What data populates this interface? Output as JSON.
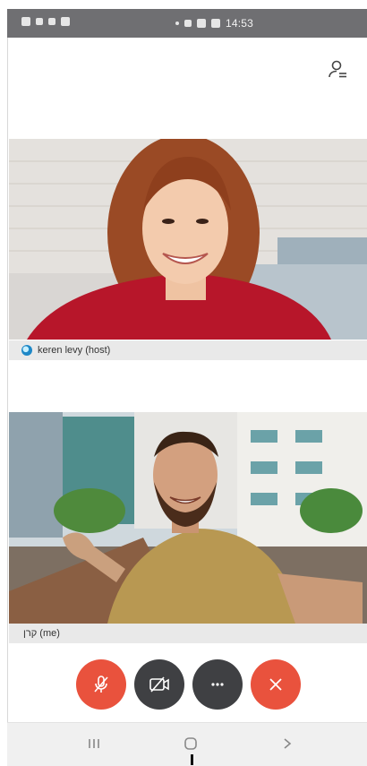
{
  "status_bar": {
    "time": "14:53",
    "icons": [
      "lock-icon",
      "signal-icon",
      "wifi-icon",
      "gallery-icon",
      "dot-icon",
      "link-icon",
      "cast-icon",
      "image-icon"
    ]
  },
  "header": {
    "participants_icon": "participants-icon"
  },
  "video_tiles": [
    {
      "id": "host",
      "label": "keren levy (host)",
      "status_icon": "connection-status-icon"
    },
    {
      "id": "me",
      "label": "קרן (me)"
    }
  ],
  "controls": [
    {
      "name": "mute-mic",
      "icon": "mic-off-icon",
      "color": "#e9523d"
    },
    {
      "name": "toggle-video",
      "icon": "video-off-icon",
      "color": "#3f4043"
    },
    {
      "name": "more-options",
      "icon": "more-icon",
      "color": "#3f4043"
    },
    {
      "name": "end-call",
      "icon": "close-icon",
      "color": "#e9523d"
    }
  ],
  "nav_bar": {
    "buttons": [
      "recent-apps-icon",
      "home-icon",
      "back-icon"
    ]
  }
}
